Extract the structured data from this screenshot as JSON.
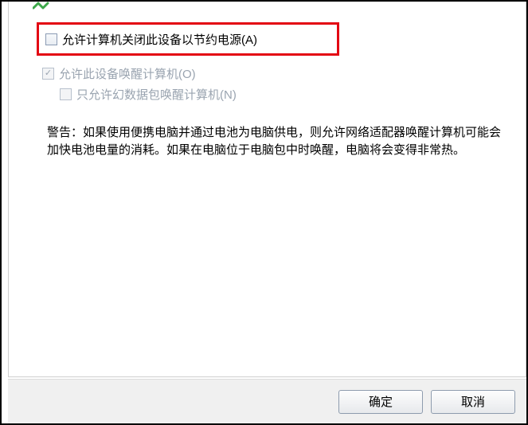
{
  "options": {
    "allow_power_off": {
      "label": "允许计算机关闭此设备以节约电源(A)",
      "checked": false,
      "enabled": true
    },
    "allow_wake": {
      "label": "允许此设备唤醒计算机(O)",
      "checked": true,
      "enabled": false
    },
    "magic_packet_only": {
      "label": "只允许幻数据包唤醒计算机(N)",
      "checked": false,
      "enabled": false
    }
  },
  "warning": "警告：如果使用便携电脑并通过电池为电脑供电，则允许网络适配器唤醒计算机可能会加快电池电量的消耗。如果在电脑位于电脑包中时唤醒，电脑将会变得非常热。",
  "buttons": {
    "ok": "确定",
    "cancel": "取消"
  }
}
